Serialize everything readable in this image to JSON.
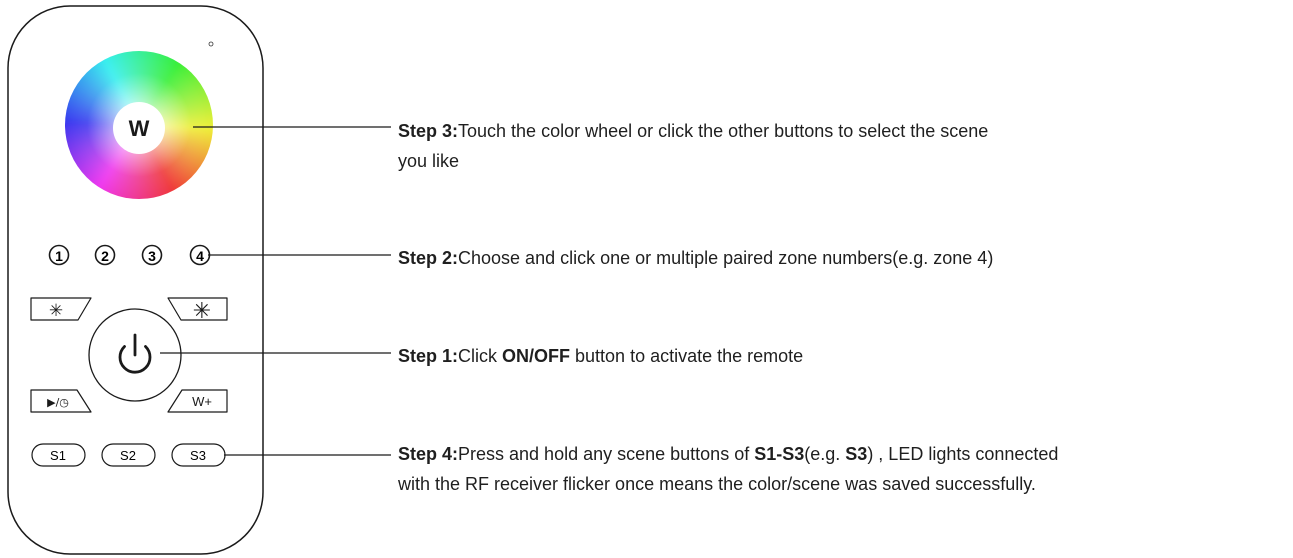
{
  "remote": {
    "wheel_center_label": "W",
    "zones": [
      "1",
      "2",
      "3",
      "4"
    ],
    "brightness_down_symbol": "✳",
    "brightness_up_symbol": "✳",
    "power_symbol": "⏻",
    "mode_label": "▶/◷",
    "white_plus_label": "W+",
    "scene_buttons": [
      "S1",
      "S2",
      "S3"
    ]
  },
  "steps": {
    "step3": {
      "title": "Step 3:",
      "text": "Touch the color wheel or click the other buttons to select the scene",
      "text2": "you like"
    },
    "step2": {
      "title": "Step 2:",
      "text": "Choose and click one or multiple paired zone numbers(e.g. zone 4)"
    },
    "step1": {
      "title": "Step 1:",
      "pre": "Click ",
      "bold": "ON/OFF",
      "post": " button to activate the remote"
    },
    "step4": {
      "title": "Step 4:",
      "pre": "Press and hold any scene buttons of ",
      "bold1": "S1-S3",
      "mid": "(e.g. ",
      "bold2": "S3",
      "post": ") , LED lights connected",
      "line2": "with the RF receiver flicker once means the color/scene was saved successfully."
    }
  },
  "colors": {
    "outline": "#1a1a1a",
    "text": "#1f1f1f"
  }
}
